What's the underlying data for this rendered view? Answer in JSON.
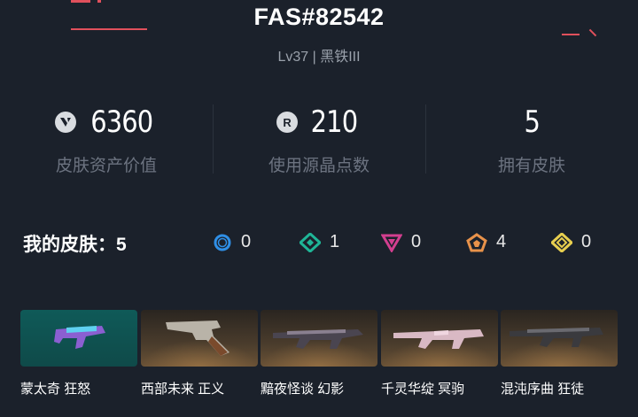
{
  "profile": {
    "name": "FAS#82542",
    "subtitle": "Lv37 | 黑铁III"
  },
  "stats": [
    {
      "icon": "valorant-points-icon",
      "value": "6360",
      "label": "皮肤资产价值"
    },
    {
      "icon": "radianite-points-icon",
      "value": "210",
      "label": "使用源晶点数"
    },
    {
      "icon": "",
      "value": "5",
      "label": "拥有皮肤"
    }
  ],
  "skins": {
    "header": "我的皮肤：5",
    "rarities": [
      {
        "icon": "select-tier-icon",
        "color": "#2f8fe6",
        "count": "0"
      },
      {
        "icon": "deluxe-tier-icon",
        "color": "#1fb597",
        "count": "1"
      },
      {
        "icon": "premium-tier-icon",
        "color": "#d33f8f",
        "count": "0"
      },
      {
        "icon": "exclusive-tier-icon",
        "color": "#e8924a",
        "count": "4"
      },
      {
        "icon": "ultra-tier-icon",
        "color": "#e8cf4f",
        "count": "0"
      }
    ],
    "items": [
      {
        "name": "蒙太奇 狂怒",
        "bg": "teal"
      },
      {
        "name": "西部未来 正义",
        "bg": "bronze"
      },
      {
        "name": "黯夜怪谈 幻影",
        "bg": "bronze"
      },
      {
        "name": "千灵华绽 冥驹",
        "bg": "bronze"
      },
      {
        "name": "混沌序曲 狂徒",
        "bg": "bronze"
      }
    ]
  },
  "colors": {
    "background": "#1b212b",
    "accent": "#e0505c",
    "muted_text": "#6c7380"
  }
}
